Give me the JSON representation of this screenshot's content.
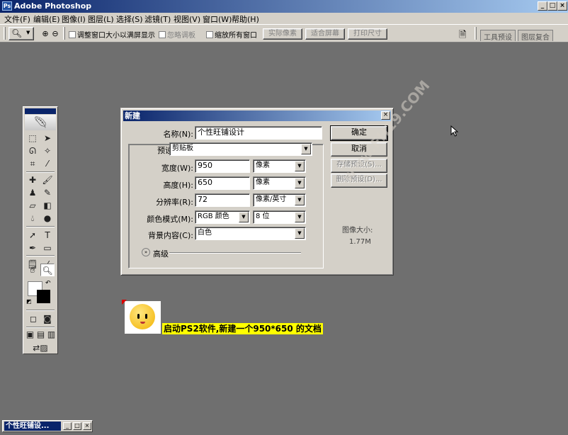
{
  "app": {
    "title": "Adobe Photoshop",
    "icon": "photoshop-app-icon",
    "window_buttons": {
      "minimize": "_",
      "maximize": "□",
      "close": "×"
    }
  },
  "menu": [
    "文件(F)",
    "编辑(E)",
    "图像(I)",
    "图层(L)",
    "选择(S)",
    "滤镜(T)",
    "视图(V)",
    "窗口(W)",
    "帮助(H)"
  ],
  "options_bar": {
    "resize_windows": "调整窗口大小以满屏显示",
    "ignore_palettes": "忽略调板",
    "zoom_all_windows": "缩放所有窗口",
    "actual_pixels": "实际像素",
    "fit_on_screen": "适合屏幕",
    "print_size": "打印尺寸",
    "tab_tool_presets": "工具预设",
    "tab_layer_comps": "图层复合"
  },
  "dialog": {
    "title": "新建",
    "name_label": "名称(N):",
    "name_value": "个性旺铺设计",
    "preset_label": "预设(P):",
    "preset_value": "剪贴板",
    "width_label": "宽度(W):",
    "width_value": "950",
    "width_unit": "像素",
    "height_label": "高度(H):",
    "height_value": "650",
    "height_unit": "像素",
    "resolution_label": "分辨率(R):",
    "resolution_value": "72",
    "resolution_unit": "像素/英寸",
    "mode_label": "颜色模式(M):",
    "mode_value": "RGB 颜色",
    "bit_value": "8 位",
    "bg_label": "背景内容(C):",
    "bg_value": "白色",
    "advanced_label": "高级",
    "ok": "确定",
    "cancel": "取消",
    "save_preset": "存储预设(S)...",
    "delete_preset": "删除预设(D)...",
    "image_size_label": "图像大小:",
    "image_size_value": "1.77M"
  },
  "caption": "启动PS2软件,新建一个950*650 的文档",
  "watermark": "www.FH19.COM",
  "minimized_doc": {
    "title": "个性旺铺设..."
  },
  "colors": {
    "workspace": "#6f6f6f",
    "titlebar_start": "#0a246a",
    "titlebar_end": "#a6caf0",
    "chrome": "#d4d0c8",
    "caption_bg": "#ffff00"
  }
}
